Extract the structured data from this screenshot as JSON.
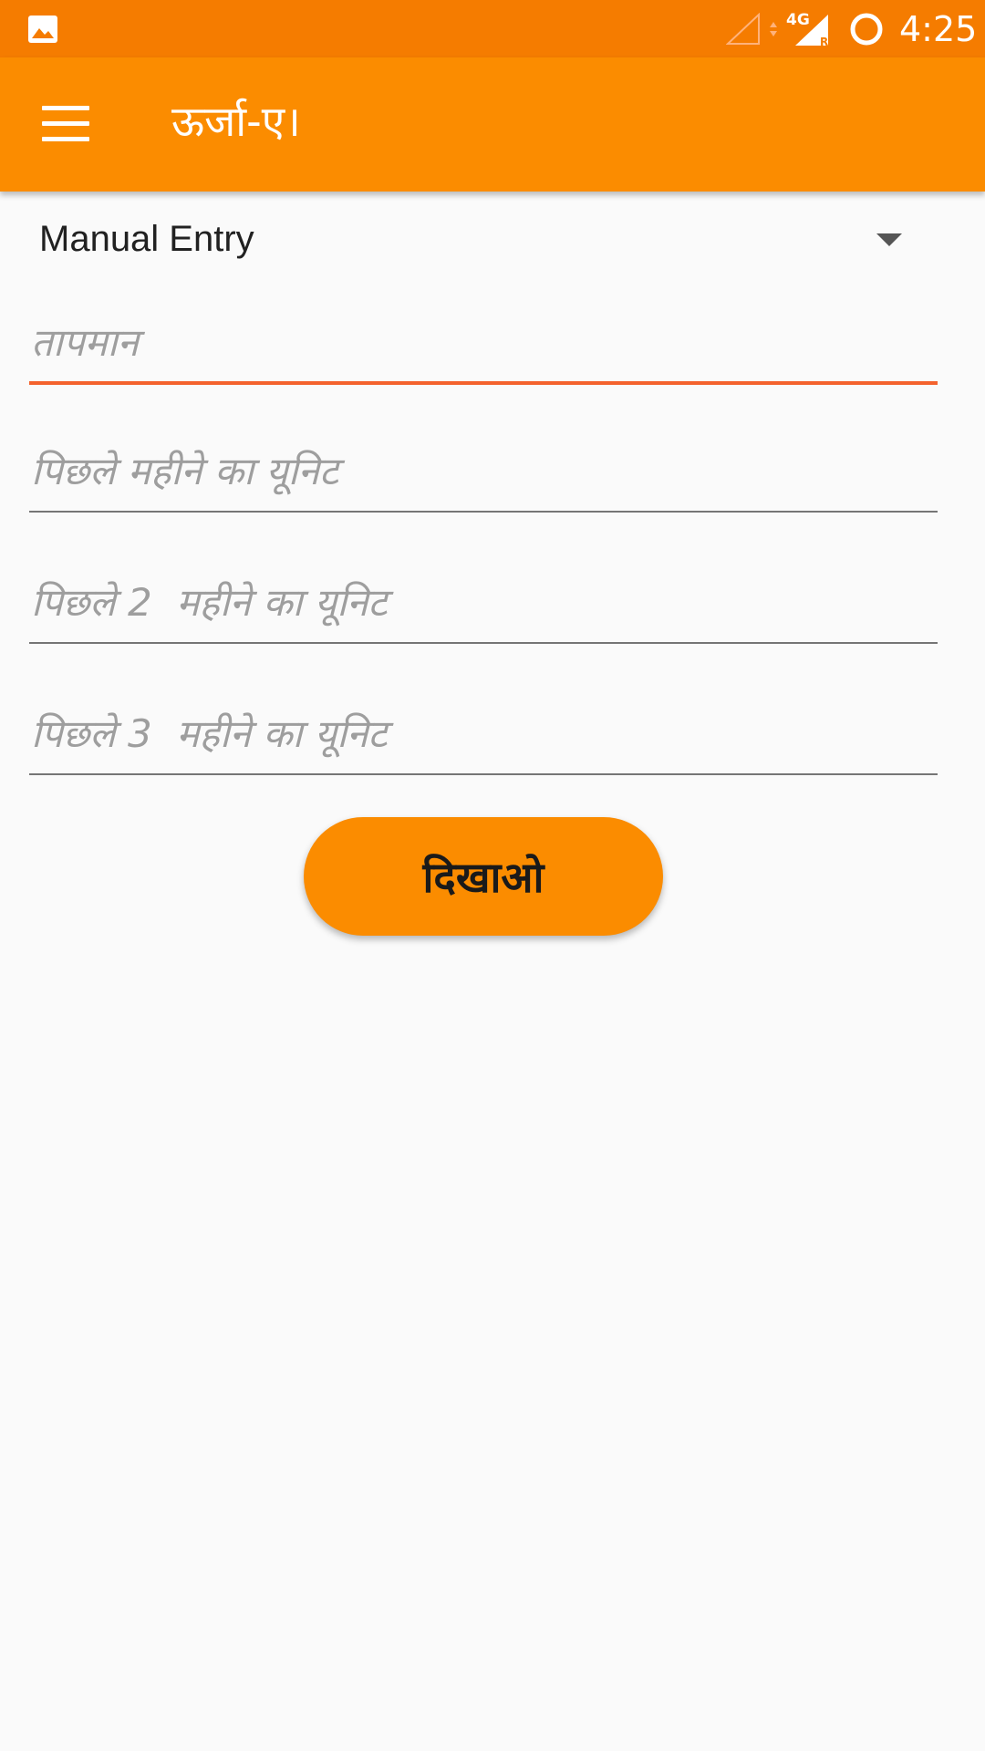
{
  "status_bar": {
    "time": "4:25",
    "network_type": "4G",
    "icons": [
      "gallery-icon",
      "signal-empty-icon",
      "data-arrows-icon",
      "signal-full-icon",
      "battery-ring-icon"
    ]
  },
  "app_bar": {
    "title": "ऊर्जा-ए।",
    "menu_icon": "hamburger-menu-icon",
    "background_color": "#fb8c00",
    "status_bar_color": "#f57c00"
  },
  "entry_mode": {
    "selected": "Manual Entry"
  },
  "form": {
    "fields": [
      {
        "placeholder": "तापमान",
        "value": "",
        "focused": true
      },
      {
        "placeholder": "पिछले महीने का यूनिट",
        "value": "",
        "focused": false
      },
      {
        "placeholder": "पिछले 2  महीने का यूनिट",
        "value": "",
        "focused": false
      },
      {
        "placeholder": "पिछले 3  महीने का यूनिट",
        "value": "",
        "focused": false
      }
    ],
    "focus_color": "#f4622d"
  },
  "actions": {
    "show_label": "दिखाओ"
  }
}
